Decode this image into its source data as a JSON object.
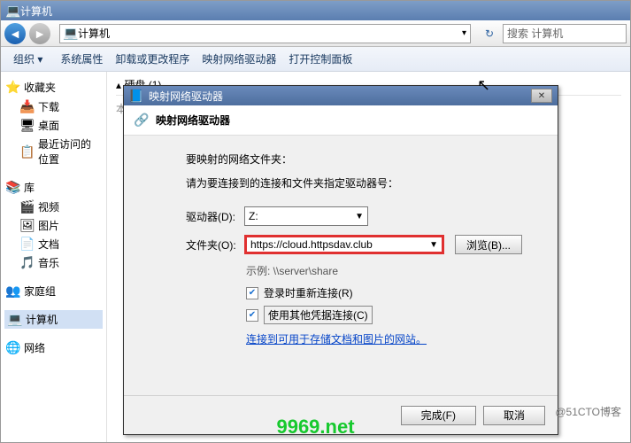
{
  "window_title": "计算机",
  "address_icon": "💻",
  "address_text": "计算机",
  "search_placeholder": "搜索 计算机",
  "toolbar": {
    "org": "组织 ▾",
    "props": "系统属性",
    "uninstall": "卸载或更改程序",
    "mapdrive": "映射网络驱动器",
    "ctrlpanel": "打开控制面板"
  },
  "sidebar": {
    "fav": "收藏夹",
    "downloads": "下载",
    "desktop": "桌面",
    "recent": "最近访问的位置",
    "lib": "库",
    "videos": "视频",
    "pics": "图片",
    "docs": "文档",
    "music": "音乐",
    "homegroup": "家庭组",
    "computer": "计算机",
    "network": "网络"
  },
  "content": {
    "drives_hdr": "▴ 硬盘 (1)",
    "local_c": "本地磁盘 (C:)"
  },
  "dialog": {
    "title": "映射网络驱动器",
    "sub": "映射网络驱动器",
    "heading": "要映射的网络文件夹：",
    "desc": "请为要连接到的连接和文件夹指定驱动器号：",
    "drive_lbl": "驱动器(D):",
    "drive_val": "Z:",
    "folder_lbl": "文件夹(O):",
    "folder_val": "https://cloud.httpsdav.club",
    "browse": "浏览(B)...",
    "example": "示例: \\\\server\\share",
    "reconnect": "登录时重新连接(R)",
    "othercred": "使用其他凭据连接(C)",
    "link": "连接到可用于存储文档和图片的网站。",
    "finish": "完成(F)",
    "cancel": "取消"
  },
  "watermark1": "@51CTO博客",
  "watermark2": "9969.net"
}
